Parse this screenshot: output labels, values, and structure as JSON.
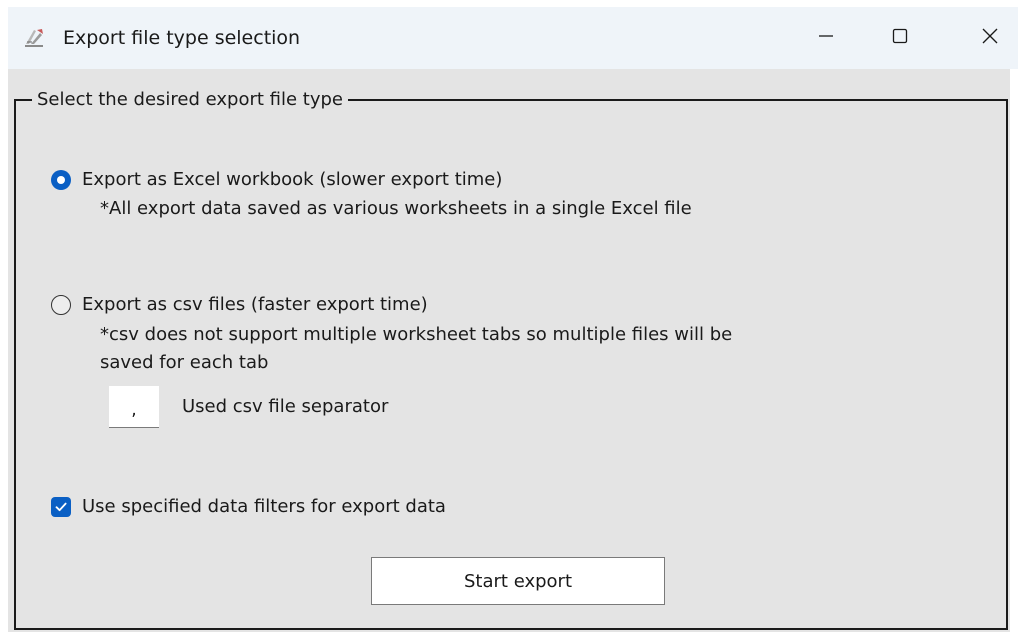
{
  "window": {
    "title": "Export file type selection",
    "app_icon": "export-tool-icon",
    "controls": {
      "minimize_icon": "minimize-icon",
      "maximize_icon": "maximize-icon",
      "close_icon": "close-icon"
    }
  },
  "group": {
    "legend": "Select the desired export file type"
  },
  "options": {
    "excel": {
      "label": "Export as Excel workbook (slower export time)",
      "note": "*All export data saved as various worksheets in a single Excel file",
      "selected": true
    },
    "csv": {
      "label": "Export as csv files (faster export time)",
      "note_line1": "*csv does not support multiple worksheet tabs so multiple files will be",
      "note_line2": "saved for each tab",
      "selected": false
    }
  },
  "separator": {
    "value": ",",
    "label": "Used csv file separator"
  },
  "filters": {
    "label": "Use specified data filters for export data",
    "checked": true
  },
  "actions": {
    "start_label": "Start export"
  },
  "colors": {
    "accent": "#0a5fc4",
    "titlebar": "#eff4f9",
    "client_background": "#e4e4e4"
  }
}
